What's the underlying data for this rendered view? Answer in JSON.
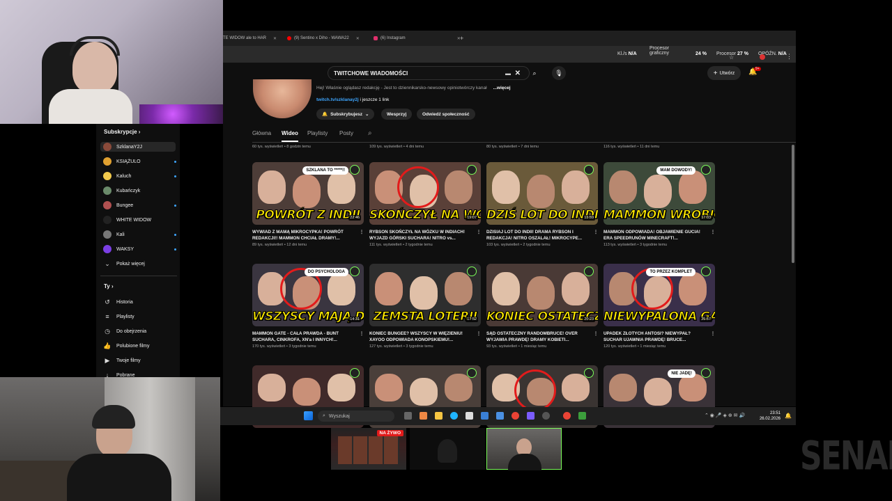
{
  "browser": {
    "tabs": [
      {
        "label": "TE WIDOW ale to HAR",
        "color": "#888888"
      },
      {
        "label": "(9) Sentino x Diho - WAWA22",
        "color": "#ff0000"
      },
      {
        "label": "(6) Instagram",
        "color": "#e1306c"
      }
    ],
    "new_tab": "+",
    "perf": {
      "ki_label": "Kl./s",
      "ki_value": "N/A",
      "gpu_label": "Procesor graficzny",
      "gpu_value": "24 %",
      "cpu_label": "Procesor",
      "cpu_value": "27 %",
      "delay_label": "OPÓŹN.",
      "delay_value": "N/A"
    }
  },
  "youtube": {
    "search_value": "TWITCHOWE WIADOMOŚCI",
    "create_label": "Utwórz",
    "notif_count": "9+",
    "channel": {
      "description": "Hej! Właśnie oglądasz redakcję - Jest to dziennikarsko-newsowy opiniotwórczy kanał",
      "more": "...więcej",
      "link": "twitch.tv/szklanay2j",
      "link_extra": " i jeszcze 1 link",
      "subscribed": "Subskrybujesz",
      "support": "Wesprzyj",
      "community": "Odwiedź społeczność"
    },
    "tabs": [
      "Główna",
      "Wideo",
      "Playlisty",
      "Posty"
    ],
    "active_tab": "Wideo",
    "prev_row_meta": [
      "60 tys. wyświetleń • 8 godzin temu",
      "109 tys. wyświetleń • 4 dni temu",
      "80 tys. wyświetleń • 7 dni temu",
      "116 tys. wyświetleń • 11 dni temu"
    ],
    "videos": [
      {
        "caption": "POWRÓT Z INDII",
        "duration": "22:46",
        "title": "WYWIAD Z MAMĄ MIKROCYPKA! POWRÓT REDAKCJI!! MAMMON CHCIAŁ DRAMY!...",
        "meta": "89 tys. wyświetleń • 12 dni temu",
        "bubble": "SZKLANA TO *****!!",
        "bg": "#4d3d38"
      },
      {
        "caption": "SKOŃCZYŁ NA WÓZKU",
        "duration": "19:07",
        "title": "RYBSON SKOŃCZYŁ NA WÓZKU W INDIACH! WYJAZD GÓRSKI SUCHARA! NITRO vs...",
        "meta": "111 tys. wyświetleń • 2 tygodnie temu",
        "bubble": "",
        "bg": "#5a4038"
      },
      {
        "caption": "DZIŚ LOT DO INDII",
        "duration": "13:59",
        "title": "DZISIAJ LOT DO INDII! DRAMA RYBSON I REDAKCJA! NITRO OSZALAŁ! MIKROCYPE...",
        "meta": "103 tys. wyświetleń • 2 tygodnie temu",
        "bubble": "",
        "bg": "#6a5a3a"
      },
      {
        "caption": "MAMMON WROBIONY",
        "duration": "17:03",
        "title": "MAMMON ODPOWIADA! OBJAWIENIE GUCIA! ERA SPEEDRUNÓW MINECRAFT!...",
        "meta": "113 tys. wyświetleń • 3 tygodnie temu",
        "bubble": "MAM DOWODY!",
        "bg": "#3d4a3a"
      },
      {
        "caption": "WSZYSCY MAJĄ DOŚĆ",
        "duration": "14:31",
        "title": "MAMMON GATE - CAŁA PRAWDA - BUNT SUCHARA, CINKROFA, XN'a I INNYCH!...",
        "meta": "170 tys. wyświetleń • 3 tygodnie temu",
        "bubble": "DO PSYCHOLOGA",
        "bg": "#3a3540"
      },
      {
        "caption": "ZEMSTA LOTERII",
        "duration": "17:52",
        "title": "KONIEC BUNGEE? WSZYSCY W WIĘZIENIU! XAYOO ODPOWIADA KONOPSKIEMU!...",
        "meta": "127 tys. wyświetleń • 3 tygodnie temu",
        "bubble": "",
        "bg": "#2e2e2e"
      },
      {
        "caption": "KONIEC OSTATECZNY",
        "duration": "20:23",
        "title": "SĄD OSTATECZNY RANDOMBRUCE! OVER WYJAWIA PRAWDĘ! DRAMY KOBIETI...",
        "meta": "93 tys. wyświetleń • 1 miesiąc temu",
        "bubble": "",
        "bg": "#4a3a36"
      },
      {
        "caption": "NIEWYPALONA GALA",
        "duration": "25:57",
        "title": "UPADEK ZŁOTYCH ANTOSI? NIEWYPAŁ? SUCHAR UJAWNIA PRAWDĘ! BRUCE...",
        "meta": "120 tys. wyświetleń • 1 miesiąc temu",
        "bubble": "TO PRZEZ KOMPLET",
        "bg": "#3a2f4a"
      },
      {
        "caption": "",
        "duration": "",
        "title": "",
        "meta": "",
        "bubble": "",
        "bg": "#402a2a"
      },
      {
        "caption": "",
        "duration": "",
        "title": "",
        "meta": "",
        "bubble": "",
        "bg": "#4a3f3a"
      },
      {
        "caption": "",
        "duration": "",
        "title": "",
        "meta": "",
        "bubble": "",
        "bg": "#3a3432"
      },
      {
        "caption": "",
        "duration": "",
        "title": "",
        "meta": "",
        "bubble": "NIE JADĘ!",
        "bg": "#3a3238"
      }
    ]
  },
  "sidebar": {
    "subs_header": "Subskrypcje",
    "items": [
      {
        "label": "SzklanaY2J",
        "color": "#8a4a3a",
        "dot": false
      },
      {
        "label": "KSIĄŻULO",
        "color": "#e0a030",
        "dot": true
      },
      {
        "label": "Kaluch",
        "color": "#f2c94c",
        "dot": true
      },
      {
        "label": "Kubańczyk",
        "color": "#6a8a6a",
        "dot": false
      },
      {
        "label": "Bungee",
        "color": "#b05050",
        "dot": true
      },
      {
        "label": "WHITE WIDOW",
        "color": "#222222",
        "dot": false
      },
      {
        "label": "Kali",
        "color": "#777777",
        "dot": true
      },
      {
        "label": "WAKSY",
        "color": "#7b3fe4",
        "dot": true
      }
    ],
    "show_more": "Pokaż więcej",
    "you_header": "Ty",
    "you_items": [
      {
        "label": "Historia",
        "icon": "history-icon",
        "glyph": "↺"
      },
      {
        "label": "Playlisty",
        "icon": "playlist-icon",
        "glyph": "≡"
      },
      {
        "label": "Do obejrzenia",
        "icon": "clock-icon",
        "glyph": "◷"
      },
      {
        "label": "Polubione filmy",
        "icon": "thumbs-up-icon",
        "glyph": "👍"
      },
      {
        "label": "Twoje filmy",
        "icon": "video-icon",
        "glyph": "▶"
      },
      {
        "label": "Pobrane",
        "icon": "download-icon",
        "glyph": "↓"
      }
    ]
  },
  "taskbar": {
    "search_label": "Wyszukaj",
    "time": "23:51",
    "date": "26.02.2026"
  },
  "scenes": {
    "live_label": "NA ŻYWO"
  },
  "watermark": "SENAK"
}
